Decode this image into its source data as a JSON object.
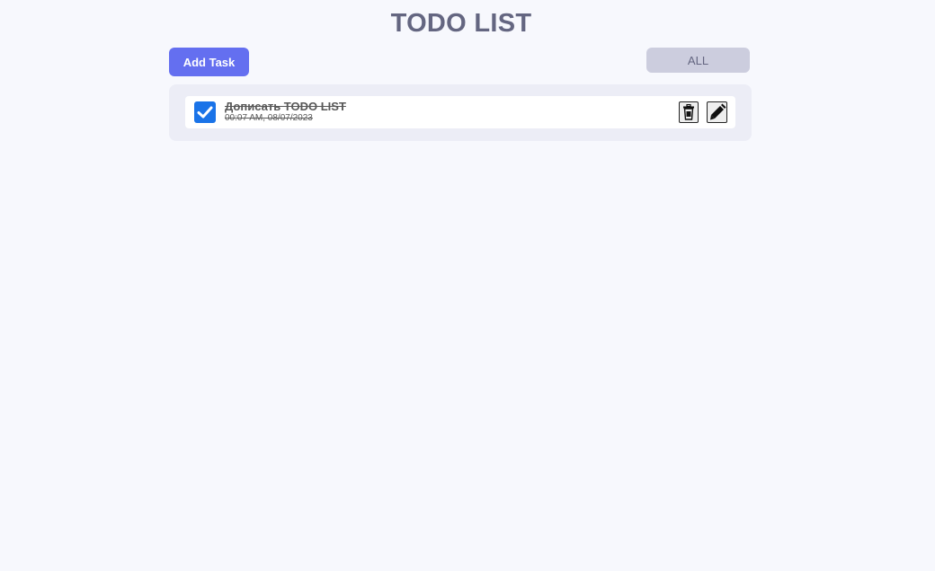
{
  "header": {
    "title": "TODO LIST"
  },
  "toolbar": {
    "add_label": "Add Task",
    "filter_value": "ALL"
  },
  "todos": [
    {
      "title": "Дописать TODO LIST",
      "time": "00:07 AM, 08/07/2023",
      "completed": true
    }
  ],
  "colors": {
    "background": "#f7f8fd",
    "primary": "#646ff0",
    "checkbox": "#1a73e8",
    "title": "#646681"
  }
}
